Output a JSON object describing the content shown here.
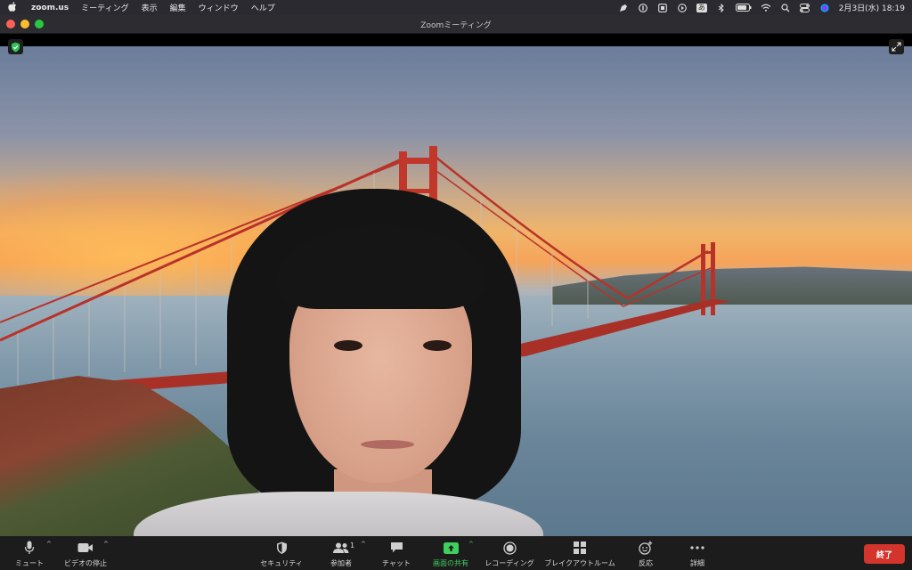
{
  "menubar": {
    "app_name": "zoom.us",
    "menus": [
      "ミーティング",
      "表示",
      "編集",
      "ウィンドウ",
      "ヘルプ"
    ],
    "status_icons": [
      "pen-icon",
      "one-password-icon",
      "screen-record-icon",
      "play-icon",
      "input-method-icon",
      "bluetooth-icon",
      "battery-icon",
      "wifi-icon",
      "search-icon",
      "control-center-icon",
      "siri-icon"
    ],
    "input_method_label": "あ",
    "clock": "2月3日(水)  18:19"
  },
  "window": {
    "title": "Zoomミーティング"
  },
  "toolbar": {
    "mute_label": "ミュート",
    "video_label": "ビデオの停止",
    "security_label": "セキュリティ",
    "participants_label": "参加者",
    "participants_count": "1",
    "chat_label": "チャット",
    "share_label": "画面の共有",
    "record_label": "レコーディング",
    "breakout_label": "ブレイクアウトルーム",
    "reactions_label": "反応",
    "more_label": "詳細",
    "end_label": "終了"
  },
  "colors": {
    "share_green": "#3fcf5e",
    "end_red": "#d3342c",
    "toolbar_bg": "#1c1c1c"
  }
}
